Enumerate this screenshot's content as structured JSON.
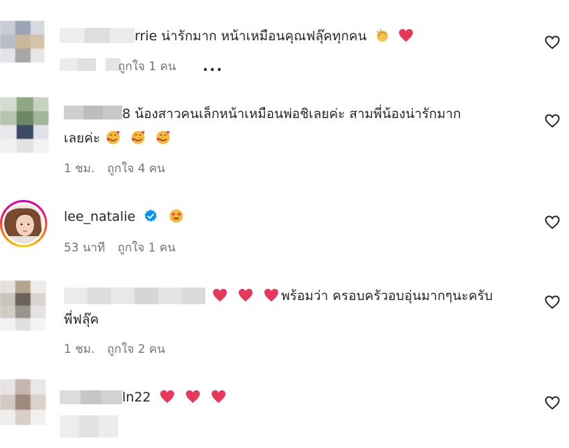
{
  "comments": [
    {
      "username_suffix": "rrie",
      "text": " น่ารักมาก หน้าเหมือนคุณฟลุ๊คทุกคน",
      "meta_likes": "ถูกใจ 1 คน",
      "more_glyph": "•••"
    },
    {
      "username_suffix": "8",
      "text_line1": " น้องสาวคนเล็กหน้าเหมือนพ่อชิเลยค่ะ สามพี่น้องน่ารักมาก",
      "text_line2": "เลยค่ะ",
      "meta_time": "1 ชม.",
      "meta_likes": "ถูกใจ 4 คน"
    },
    {
      "username": "lee_natalie",
      "meta_time": "53 นาที",
      "meta_likes": "ถูกใจ 1 คน"
    },
    {
      "text_line1": "พร้อมว่า ครอบครัวอบอุ่นมากๆนะครับ",
      "text_line2": "พี่ฟลุ๊ค",
      "meta_time": "1 ชม.",
      "meta_likes": "ถูกใจ 2 คน"
    },
    {
      "username_suffix": "ln22"
    }
  ],
  "colors": {
    "heart_emoji": "#e8385a",
    "verified": "#0095f6",
    "meta_text": "#737373",
    "like_outline": "#262626"
  },
  "icons": [
    "like-heart-outline",
    "red-heart-emoji",
    "clapping-hands-emoji",
    "smiling-face-with-hearts-emoji",
    "heart-eyes-emoji",
    "verified-badge"
  ]
}
